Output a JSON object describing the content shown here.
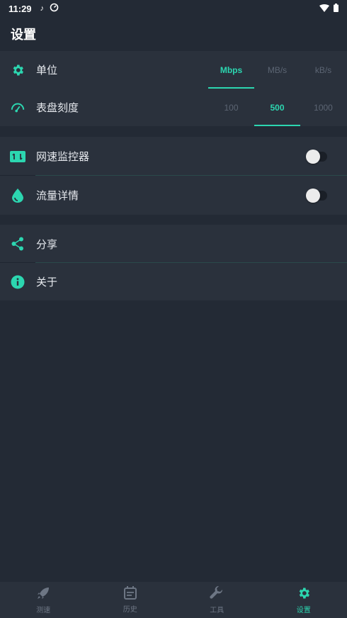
{
  "status_bar": {
    "time": "11:29",
    "icons": [
      "music-note-icon",
      "speedometer-icon",
      "wifi-icon",
      "battery-icon"
    ]
  },
  "header": {
    "title": "设置"
  },
  "settings": {
    "unit": {
      "label": "单位",
      "icon": "gear-icon",
      "options": [
        "Mbps",
        "MB/s",
        "kB/s"
      ],
      "selected": "Mbps"
    },
    "dial": {
      "label": "表盘刻度",
      "icon": "gauge-icon",
      "options": [
        "100",
        "500",
        "1000"
      ],
      "selected": "500"
    },
    "monitor": {
      "label": "网速监控器",
      "icon": "monitor-icon",
      "enabled": false
    },
    "traffic": {
      "label": "流量详情",
      "icon": "drop-icon",
      "enabled": false
    },
    "share": {
      "label": "分享",
      "icon": "share-icon"
    },
    "about": {
      "label": "关于",
      "icon": "info-icon"
    }
  },
  "bottom_nav": {
    "items": [
      {
        "label": "测速",
        "icon": "rocket-icon"
      },
      {
        "label": "历史",
        "icon": "calendar-icon"
      },
      {
        "label": "工具",
        "icon": "wrench-icon"
      },
      {
        "label": "设置",
        "icon": "gear-icon"
      }
    ],
    "active": "设置"
  },
  "colors": {
    "accent": "#2cd6b0",
    "background": "#232a35",
    "card": "#2a313c",
    "muted": "#5c6573"
  }
}
